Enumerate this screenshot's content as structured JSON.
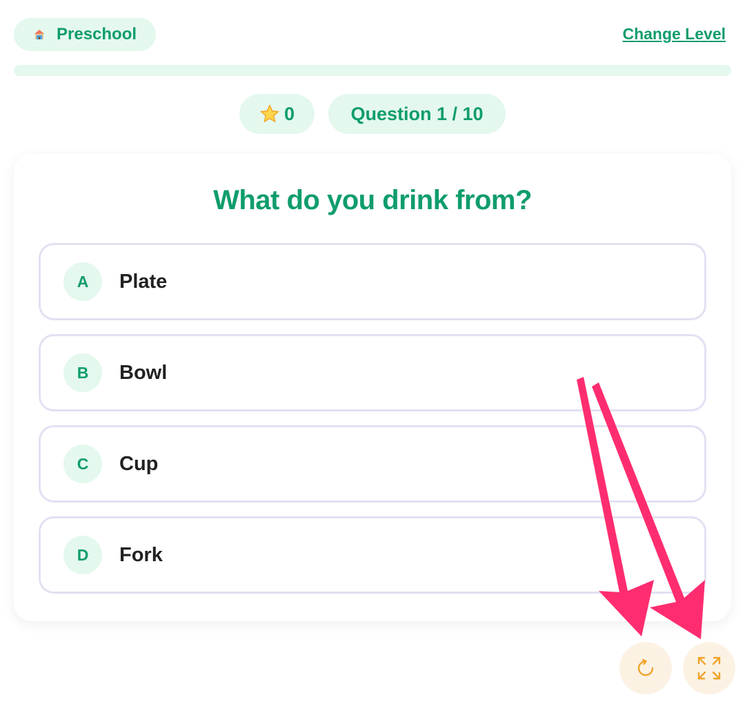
{
  "header": {
    "level_label": "Preschool",
    "level_icon": "school-building-icon",
    "change_level_label": "Change Level"
  },
  "progress": {
    "fraction": 0
  },
  "stats": {
    "stars": "0",
    "star_icon": "star-icon",
    "question_counter": "Question 1 / 10"
  },
  "quiz": {
    "question": "What do you drink from?",
    "options": [
      {
        "letter": "A",
        "text": "Plate"
      },
      {
        "letter": "B",
        "text": "Bowl"
      },
      {
        "letter": "C",
        "text": "Cup"
      },
      {
        "letter": "D",
        "text": "Fork"
      }
    ]
  },
  "controls": {
    "restart_icon": "restart-icon",
    "fullscreen_icon": "fullscreen-icon"
  },
  "colors": {
    "accent": "#0f9d6b",
    "pill_bg": "#e4f8ee",
    "option_border": "#e3e0f2",
    "control_icon": "#f0a32a",
    "control_bg": "#fcf2e4",
    "annotation_arrow": "#ff2d6f"
  }
}
